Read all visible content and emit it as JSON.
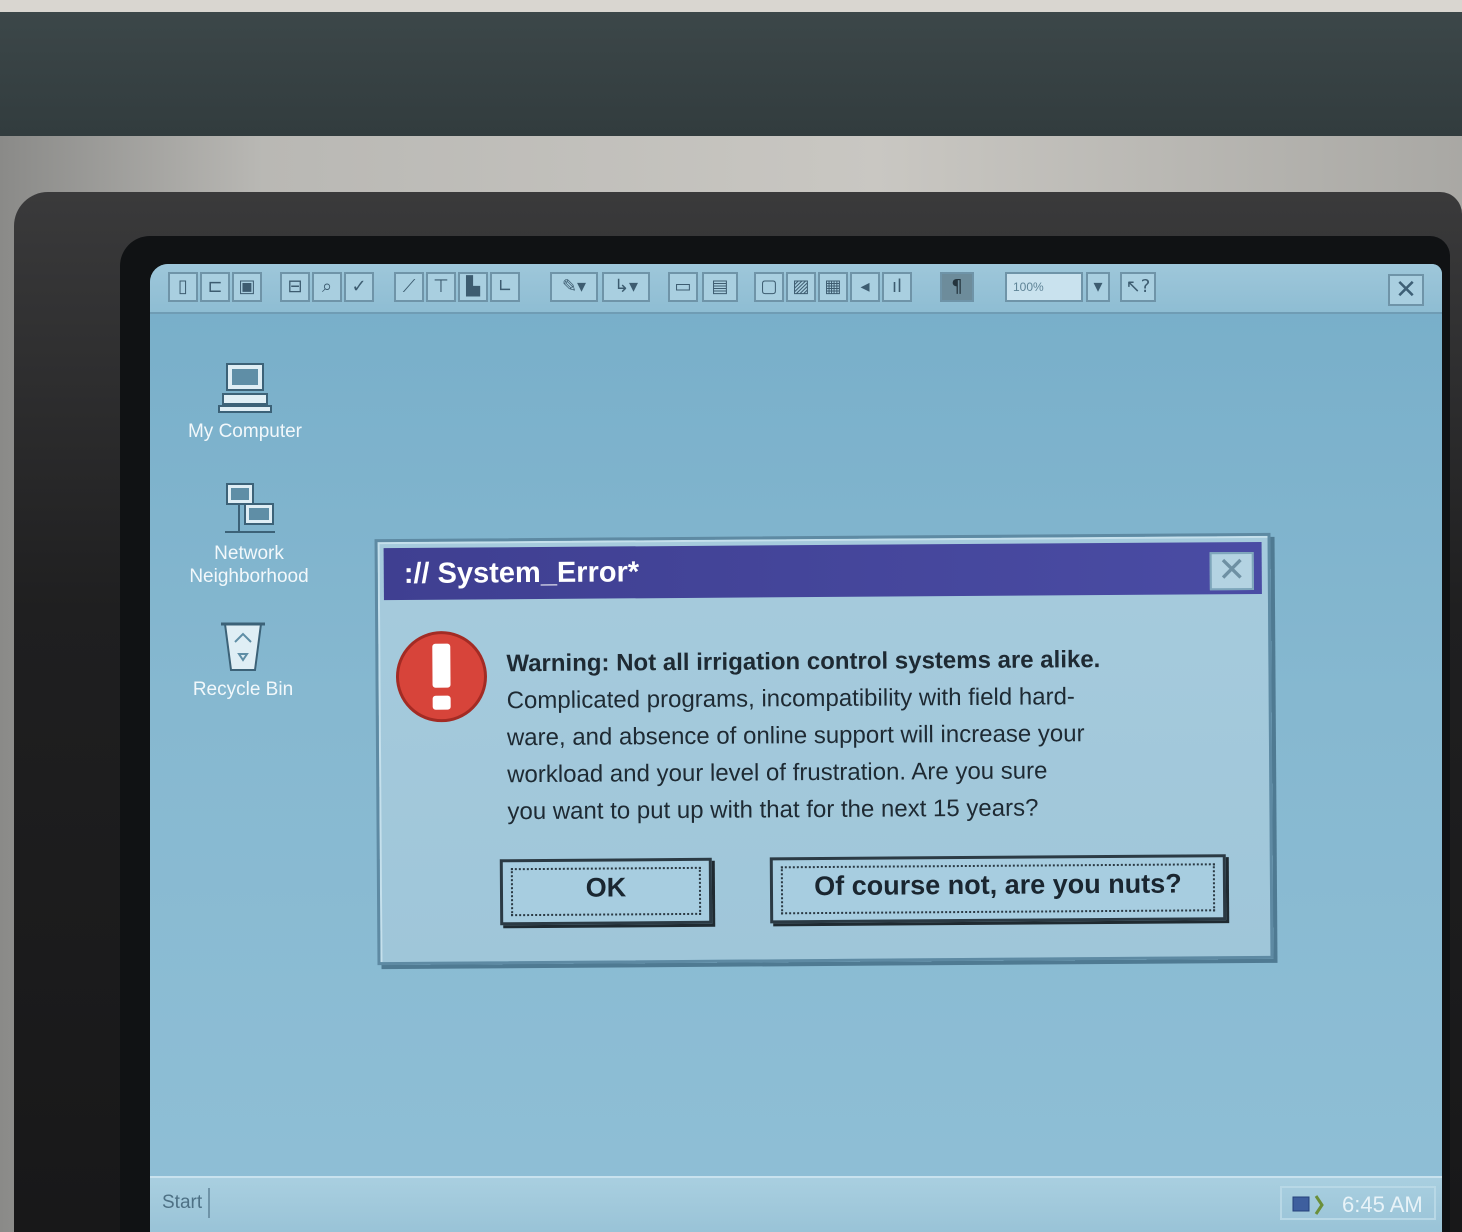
{
  "toolbar": {
    "zoom_value": "100%",
    "close_glyph": "✕",
    "buttons": [
      "new-doc-icon",
      "open-folder-icon",
      "save-icon",
      "print-icon",
      "print-preview-icon",
      "spellcheck-icon",
      "chart-icon",
      "insert-icon",
      "bar-chart-icon",
      "table-icon",
      "pen-icon",
      "arrow-icon",
      "paste-icon",
      "clipboard-icon",
      "layout-icon",
      "image-icon",
      "grid-icon",
      "sound-icon",
      "column-chart-icon",
      "paragraph-icon",
      "dropdown-icon",
      "help-pointer-icon"
    ]
  },
  "desktop_icons": [
    {
      "name": "my-computer-icon",
      "label": "My Computer"
    },
    {
      "name": "network-neighborhood-icon",
      "label": "Network Neighborhood"
    },
    {
      "name": "recycle-bin-icon",
      "label": "Recycle Bin"
    }
  ],
  "dialog": {
    "title": ":// System_Error*",
    "close_glyph": "✕",
    "headline": "Warning: Not all irrigation control systems are alike.",
    "body_lines": [
      "Complicated programs, incompatibility with field hard-",
      "ware, and absence of online support will increase your",
      "workload and your level of frustration. Are you sure",
      "you want to put up with that for the next 15 years?"
    ],
    "ok_label": "OK",
    "no_label": "Of course not, are you nuts?"
  },
  "taskbar": {
    "start_label": "Start",
    "clock": "6:45 AM"
  },
  "colors": {
    "title_bar": "#4042a0",
    "desktop": "#80b5ce",
    "warning": "#d7443a"
  }
}
